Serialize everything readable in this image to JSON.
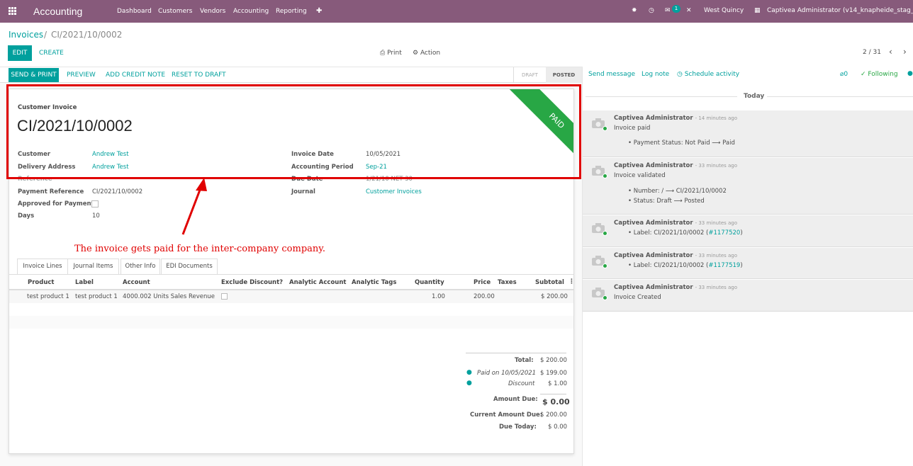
{
  "navbar": {
    "app_name": "Accounting",
    "menu": [
      "Dashboard",
      "Customers",
      "Vendors",
      "Accounting",
      "Reporting"
    ],
    "plus": "✚",
    "chat_count": "1",
    "company": "West Quincy",
    "user": "Captivea Administrator (v14_knapheide_stag_db_1)"
  },
  "breadcrumb": {
    "root": "Invoices",
    "sep": "/",
    "current": "CI/2021/10/0002"
  },
  "control": {
    "edit": "EDIT",
    "create": "CREATE",
    "print": "Print",
    "action": "Action",
    "pager": "2 / 31"
  },
  "statusbar": {
    "buttons": [
      "SEND & PRINT",
      "PREVIEW",
      "ADD CREDIT NOTE",
      "RESET TO DRAFT"
    ],
    "draft": "DRAFT",
    "posted": "POSTED"
  },
  "invoice": {
    "type": "Customer Invoice",
    "number": "CI/2021/10/0002",
    "ribbon": "PAID",
    "left": [
      {
        "label": "Customer",
        "value": "Andrew Test"
      },
      {
        "label": "Delivery Address",
        "value": "Andrew Test"
      },
      {
        "label": "Reference",
        "value": ""
      },
      {
        "label": "Payment Reference",
        "value": "CI/2021/10/0002"
      },
      {
        "label": "Approved for Payment",
        "value": ""
      },
      {
        "label": "Days",
        "value": "10"
      }
    ],
    "right": [
      {
        "label": "Invoice Date",
        "value": "10/05/2021"
      },
      {
        "label": "Accounting Period",
        "value": "Sep-21"
      },
      {
        "label": "Due Date",
        "value": "1/21/10 NET 30"
      },
      {
        "label": "Journal",
        "value": "Customer Invoices"
      }
    ]
  },
  "annotation": "The invoice gets paid for the inter-company company.",
  "tabs": [
    "Invoice Lines",
    "Journal Items",
    "Other Info",
    "EDI Documents"
  ],
  "lines": {
    "headers": [
      "Product",
      "Label",
      "Account",
      "Exclude Discount?",
      "Analytic Account",
      "Analytic Tags",
      "Quantity",
      "Price",
      "Taxes",
      "Subtotal"
    ],
    "rows": [
      {
        "product": "test product 1",
        "label": "test product 1",
        "account": "4000.002 Units Sales Revenue",
        "quantity": "1.00",
        "price": "200.00",
        "subtotal": "$ 200.00"
      }
    ]
  },
  "totals": {
    "total_label": "Total:",
    "total": "$ 200.00",
    "paid_label": "Paid on 10/05/2021",
    "paid": "$ 199.00",
    "discount_label": "Discount",
    "discount": "$ 1.00",
    "due_label": "Amount Due:",
    "due": "$ 0.00",
    "current_label": "Current Amount Due:",
    "current": "$ 200.00",
    "today_label": "Due Today:",
    "today": "$ 0.00"
  },
  "chatter": {
    "send": "Send message",
    "log": "Log note",
    "schedule": "Schedule activity",
    "attachments": "0",
    "following": "Following",
    "today": "Today",
    "messages": [
      {
        "author": "Captivea Administrator",
        "time": "- 14 minutes ago",
        "lines": [
          "Invoice paid"
        ],
        "bullets": [
          "Payment Status: Not Paid ⟶ Paid"
        ]
      },
      {
        "author": "Captivea Administrator",
        "time": "- 33 minutes ago",
        "lines": [
          "Invoice validated"
        ],
        "bullets": [
          "Number: / ⟶ CI/2021/10/0002",
          "Status: Draft ⟶ Posted"
        ]
      },
      {
        "author": "Captivea Administrator",
        "time": "- 33 minutes ago",
        "lines": [],
        "bullets": [
          "Label:  CI/2021/10/0002 (",
          "#1177520",
          ")"
        ]
      },
      {
        "author": "Captivea Administrator",
        "time": "- 33 minutes ago",
        "lines": [],
        "bullets": [
          "Label:  CI/2021/10/0002 (",
          "#1177519",
          ")"
        ]
      },
      {
        "author": "Captivea Administrator",
        "time": "- 33 minutes ago",
        "lines": [
          "Invoice Created"
        ],
        "bullets": []
      }
    ]
  }
}
